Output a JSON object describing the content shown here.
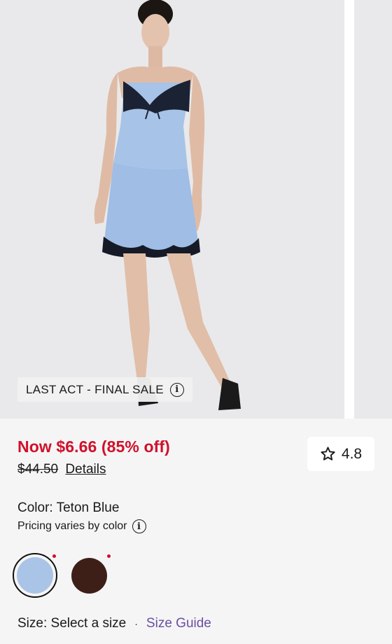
{
  "gallery": {
    "badge_text": "LAST ACT - FINAL SALE",
    "badge_icon": "info-icon"
  },
  "pricing": {
    "now_price": "Now $6.66 (85% off)",
    "original_price": "$44.50",
    "details_link": "Details",
    "sale_color": "#d1102a"
  },
  "rating": {
    "icon": "star-outline-icon",
    "value": "4.8"
  },
  "color": {
    "label": "Color: Teton Blue",
    "pricing_note": "Pricing varies by color",
    "swatches": [
      {
        "name": "Teton Blue",
        "hex": "#a9c4e6",
        "selected": true
      },
      {
        "name": "Brown",
        "hex": "#3e1f18",
        "selected": false
      }
    ]
  },
  "size": {
    "label": "Size: Select a size",
    "separator": "·",
    "guide_link": "Size Guide",
    "guide_color": "#6b4fa0"
  }
}
